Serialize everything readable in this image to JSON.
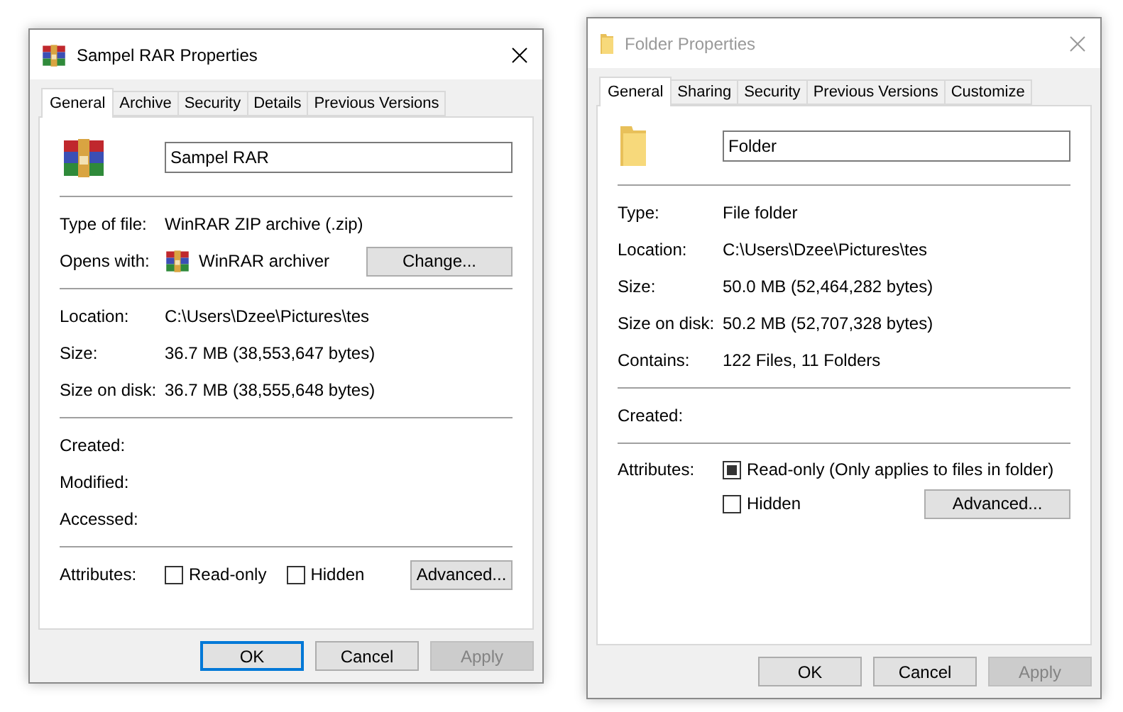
{
  "dialogs": [
    {
      "title": "Sampel RAR Properties",
      "active": true,
      "kind": "archive",
      "tabs": [
        {
          "label": "General",
          "selected": true
        },
        {
          "label": "Archive",
          "selected": false
        },
        {
          "label": "Security",
          "selected": false
        },
        {
          "label": "Details",
          "selected": false
        },
        {
          "label": "Previous Versions",
          "selected": false
        }
      ],
      "name": "Sampel RAR",
      "sections": [
        [
          {
            "kind": "text",
            "label": "Type of file:",
            "value": "WinRAR ZIP archive (.zip)"
          },
          {
            "kind": "opens",
            "label": "Opens with:",
            "value": "WinRAR archiver",
            "button": "Change..."
          }
        ],
        [
          {
            "kind": "text",
            "label": "Location:",
            "value": "C:\\Users\\Dzee\\Pictures\\tes"
          },
          {
            "kind": "text",
            "label": "Size:",
            "value": "36.7 MB (38,553,647 bytes)"
          },
          {
            "kind": "text",
            "label": "Size on disk:",
            "value": "36.7 MB (38,555,648 bytes)"
          }
        ],
        [
          {
            "kind": "text",
            "label": "Created:"
          },
          {
            "kind": "text",
            "label": "Modified:"
          },
          {
            "kind": "text",
            "label": "Accessed:"
          }
        ],
        [
          {
            "kind": "attributes_inline",
            "label": "Attributes:",
            "checkboxes": [
              {
                "label": "Read-only",
                "checked": false,
                "mixed": false
              },
              {
                "label": "Hidden",
                "checked": false,
                "mixed": false
              }
            ],
            "button": "Advanced..."
          }
        ]
      ],
      "buttons": [
        {
          "label": "OK",
          "default": true,
          "disabled": false
        },
        {
          "label": "Cancel",
          "default": false,
          "disabled": false
        },
        {
          "label": "Apply",
          "default": false,
          "disabled": true
        }
      ]
    },
    {
      "title": "Folder Properties",
      "active": false,
      "kind": "folder",
      "tabs": [
        {
          "label": "General",
          "selected": true
        },
        {
          "label": "Sharing",
          "selected": false
        },
        {
          "label": "Security",
          "selected": false
        },
        {
          "label": "Previous Versions",
          "selected": false
        },
        {
          "label": "Customize",
          "selected": false
        }
      ],
      "name": "Folder",
      "sections": [
        [
          {
            "kind": "text",
            "label": "Type:",
            "value": "File folder"
          },
          {
            "kind": "text",
            "label": "Location:",
            "value": "C:\\Users\\Dzee\\Pictures\\tes"
          },
          {
            "kind": "text",
            "label": "Size:",
            "value": "50.0 MB (52,464,282 bytes)"
          },
          {
            "kind": "text",
            "label": "Size on disk:",
            "value": "50.2 MB (52,707,328 bytes)"
          },
          {
            "kind": "text",
            "label": "Contains:",
            "value": "122 Files, 11 Folders"
          }
        ],
        [
          {
            "kind": "text",
            "label": "Created:"
          }
        ],
        [
          {
            "kind": "attributes_stacked",
            "label": "Attributes:",
            "checkboxes": [
              {
                "label": "Read-only (Only applies to files in folder)",
                "checked": false,
                "mixed": true
              },
              {
                "label": "Hidden",
                "checked": false,
                "mixed": false
              }
            ],
            "button": "Advanced..."
          }
        ]
      ],
      "buttons": [
        {
          "label": "OK",
          "default": false,
          "disabled": false
        },
        {
          "label": "Cancel",
          "default": false,
          "disabled": false
        },
        {
          "label": "Apply",
          "default": false,
          "disabled": true
        }
      ]
    }
  ]
}
